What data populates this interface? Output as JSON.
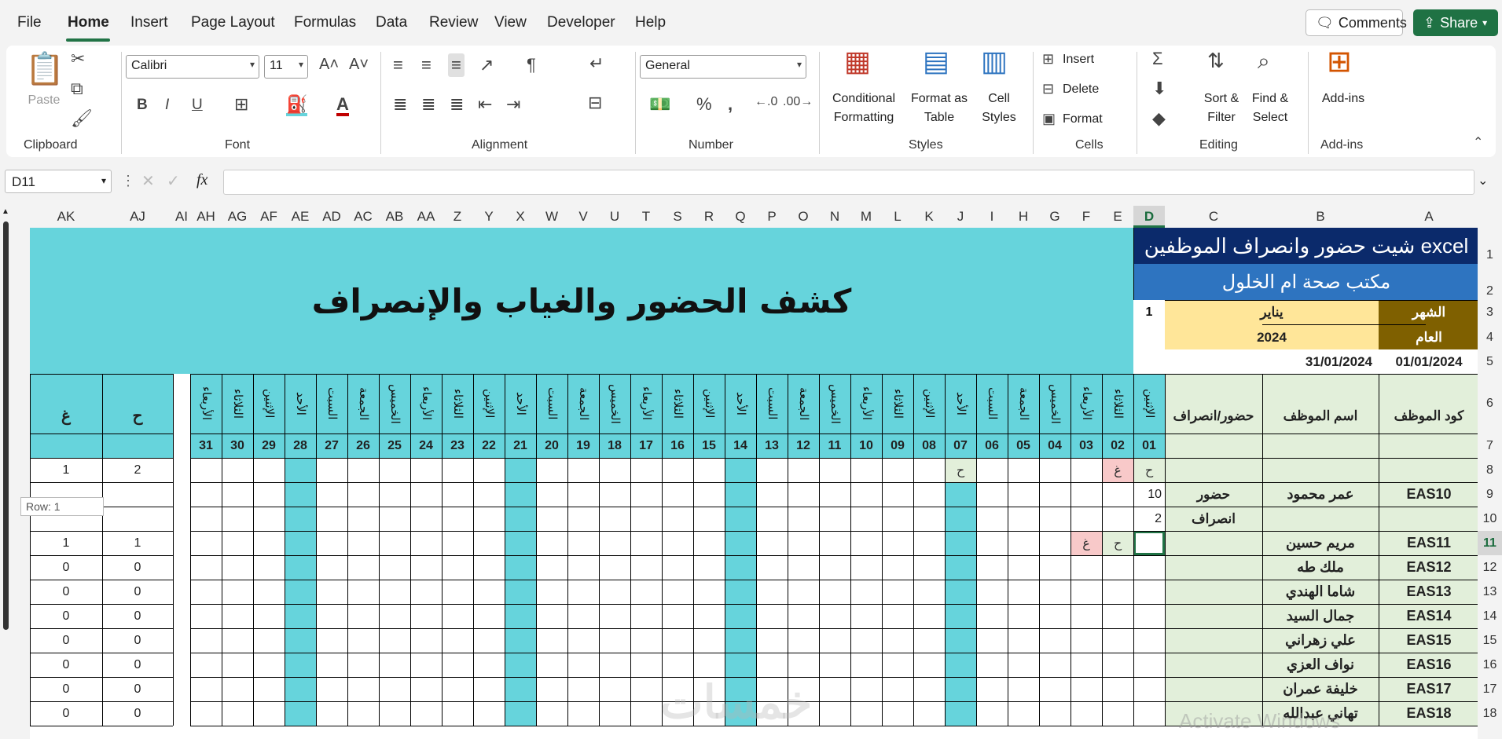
{
  "menu": {
    "items": [
      "File",
      "Home",
      "Insert",
      "Page Layout",
      "Formulas",
      "Data",
      "Review",
      "View",
      "Developer",
      "Help"
    ],
    "active": "Home",
    "comments_label": "Comments",
    "share_label": "Share"
  },
  "ribbon": {
    "clipboard": {
      "group_label": "Clipboard",
      "paste_label": "Paste"
    },
    "font": {
      "group_label": "Font",
      "font_name": "Calibri",
      "font_size": "11"
    },
    "alignment": {
      "group_label": "Alignment"
    },
    "number": {
      "group_label": "Number",
      "format": "General"
    },
    "styles": {
      "group_label": "Styles",
      "conditional_l1": "Conditional",
      "conditional_l2": "Formatting",
      "format_table_l1": "Format as",
      "format_table_l2": "Table",
      "cell_styles_l1": "Cell",
      "cell_styles_l2": "Styles"
    },
    "cells": {
      "group_label": "Cells",
      "insert": "Insert",
      "delete": "Delete",
      "format": "Format"
    },
    "editing": {
      "group_label": "Editing",
      "sort_l1": "Sort &",
      "sort_l2": "Filter",
      "find_l1": "Find &",
      "find_l2": "Select"
    },
    "addins": {
      "group_label": "Add-ins",
      "label": "Add-ins"
    }
  },
  "formula_bar": {
    "name_box": "D11",
    "formula": "",
    "fx": "fx"
  },
  "columns": [
    "AK",
    "AJ",
    "AI",
    "AH",
    "AG",
    "AF",
    "AE",
    "AD",
    "AC",
    "AB",
    "AA",
    "Z",
    "Y",
    "X",
    "W",
    "V",
    "U",
    "T",
    "S",
    "R",
    "Q",
    "P",
    "O",
    "N",
    "M",
    "L",
    "K",
    "J",
    "I",
    "H",
    "G",
    "F",
    "E",
    "D",
    "C",
    "B",
    "A"
  ],
  "selected_column": "D",
  "rows": [
    "1",
    "2",
    "3",
    "4",
    "5",
    "6",
    "7",
    "8",
    "9",
    "10",
    "11",
    "12",
    "13",
    "14",
    "15",
    "16",
    "17",
    "18"
  ],
  "selected_row": "11",
  "sheet": {
    "title": "شيت حضور وانصراف الموظفين excel",
    "office": "مكتب صحة ام الخلول",
    "big_title": "كشف الحضور والغياب والإنصراف",
    "month_label": "الشهر",
    "month_value": "يناير",
    "month_number": "1",
    "year_label": "العام",
    "year_value": "2024",
    "start_date": "01/01/2024",
    "end_date": "31/01/2024",
    "hdr_code": "كود الموظف",
    "hdr_name": "اسم الموظف",
    "hdr_inout": "حضور/انصراف",
    "hdr_present": "ح",
    "hdr_absent": "غ",
    "day_names": [
      "الإثنين",
      "الثلاثاء",
      "الأربعاء",
      "الخميس",
      "الجمعة",
      "السبت",
      "الأحد",
      "الإثنين",
      "الثلاثاء",
      "الأربعاء",
      "الخميس",
      "الجمعة",
      "السبت",
      "الأحد",
      "الإثنين",
      "الثلاثاء",
      "الأربعاء",
      "الخميس",
      "الجمعة",
      "السبت",
      "الأحد",
      "الإثنين",
      "الثلاثاء",
      "الأربعاء",
      "الخميس",
      "الجمعة",
      "السبت",
      "الأحد",
      "الإثنين",
      "الثلاثاء",
      "الأربعاء"
    ],
    "day_numbers": [
      "01",
      "02",
      "03",
      "04",
      "05",
      "06",
      "07",
      "08",
      "09",
      "10",
      "11",
      "12",
      "13",
      "14",
      "15",
      "16",
      "17",
      "18",
      "19",
      "20",
      "21",
      "22",
      "23",
      "24",
      "25",
      "26",
      "27",
      "28",
      "29",
      "30",
      "31"
    ],
    "first_employee": {
      "code": "EAS10",
      "name": "عمر محمود",
      "in_label": "حضور",
      "out_label": "انصراف",
      "present": "2",
      "absent": "1",
      "d01": "ح",
      "d02": "غ",
      "d07": "ح",
      "in_time": "10",
      "out_time": "2"
    },
    "employees": [
      {
        "code": "EAS11",
        "name": "مريم حسين",
        "present": "1",
        "absent": "1",
        "d02": "ح",
        "d03": "غ"
      },
      {
        "code": "EAS12",
        "name": "ملك طه",
        "present": "0",
        "absent": "0"
      },
      {
        "code": "EAS13",
        "name": "شاما الهندي",
        "present": "0",
        "absent": "0"
      },
      {
        "code": "EAS14",
        "name": "جمال السيد",
        "present": "0",
        "absent": "0"
      },
      {
        "code": "EAS15",
        "name": "علي زهراني",
        "present": "0",
        "absent": "0"
      },
      {
        "code": "EAS16",
        "name": "نواف العزي",
        "present": "0",
        "absent": "0"
      },
      {
        "code": "EAS17",
        "name": "خليفة عمران",
        "present": "0",
        "absent": "0"
      },
      {
        "code": "EAS18",
        "name": "تهاني عبدالله",
        "present": "0",
        "absent": "0"
      }
    ]
  },
  "row_tip": "Row: 1",
  "watermark": "Activate Windows",
  "logo_watermark": "خمسات",
  "colors": {
    "accent": "#217346",
    "teal": "#66d4dc",
    "navy": "#0b2a6b",
    "blue": "#2e74c0",
    "green": "#e2efda",
    "yellow": "#ffe699",
    "brown": "#7f6000"
  }
}
